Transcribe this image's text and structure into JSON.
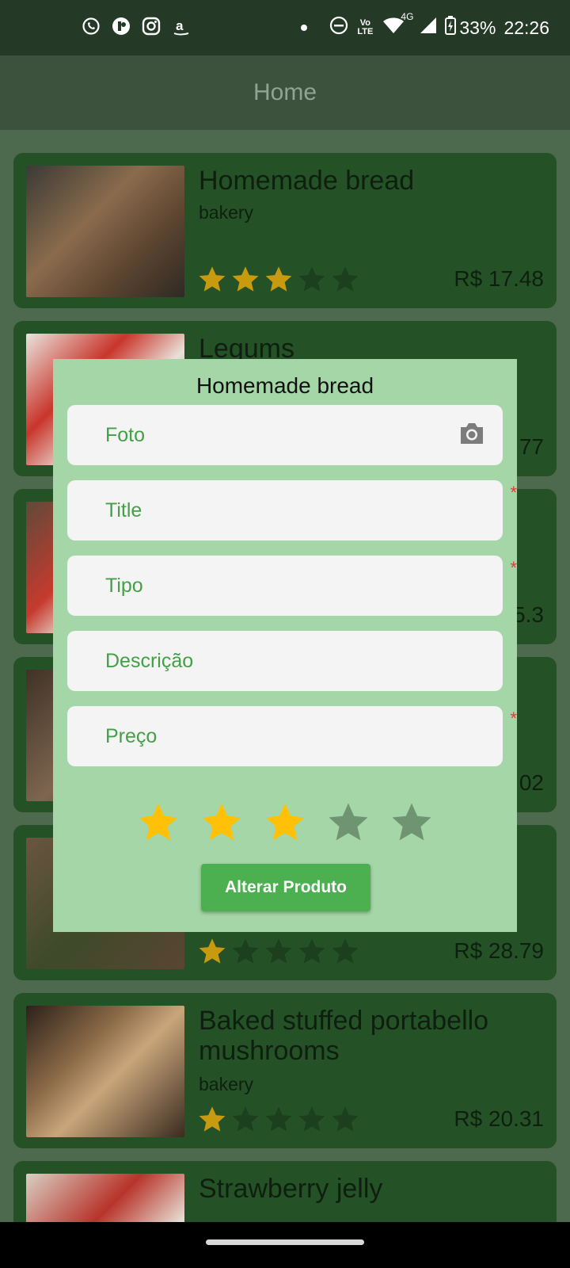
{
  "status_bar": {
    "time": "22:26",
    "battery": "33%",
    "network": "4G",
    "volte": "VoLTE",
    "left_icons": [
      "whatsapp-icon",
      "app-icon",
      "instagram-icon",
      "amazon-icon"
    ],
    "right_icons": [
      "dot-icon",
      "dnd-icon",
      "volte-icon",
      "wifi-icon",
      "signal-icon",
      "battery-icon"
    ]
  },
  "appbar": {
    "title": "Home"
  },
  "products": [
    {
      "title": "Homemade bread",
      "type": "bakery",
      "price": "R$ 17.48",
      "rating": 3
    },
    {
      "title": "Legums",
      "type": "",
      "price": "77",
      "rating": 0
    },
    {
      "title": "",
      "type": "",
      "price": "5.3",
      "rating": 0
    },
    {
      "title": "",
      "type": "",
      "price": "02",
      "rating": 0
    },
    {
      "title": "",
      "type": "",
      "price": "R$ 28.79",
      "rating": 1
    },
    {
      "title": "Baked stuffed portabello mushrooms",
      "type": "bakery",
      "price": "R$ 20.31",
      "rating": 1
    },
    {
      "title": "Strawberry jelly",
      "type": "",
      "price": "",
      "rating": 0
    }
  ],
  "dialog": {
    "title": "Homemade bread",
    "fields": {
      "foto": {
        "placeholder": "Foto",
        "required": false
      },
      "title": {
        "placeholder": "Title",
        "required": true
      },
      "tipo": {
        "placeholder": "Tipo",
        "required": true
      },
      "descricao": {
        "placeholder": "Descrição",
        "required": false
      },
      "preco": {
        "placeholder": "Preço",
        "required": true
      }
    },
    "required_mark": "*",
    "rating": 3,
    "rating_max": 5,
    "submit_label": "Alterar Produto"
  },
  "colors": {
    "accent": "#4caf50",
    "dialog_bg": "#a5d6a7",
    "card_bg": "#245226",
    "star_on": "#ffc107",
    "star_on_card": "#c79a10",
    "star_off_dialog": "#6e9472",
    "star_off_card": "#1c3f1e",
    "required": "#e53935"
  }
}
